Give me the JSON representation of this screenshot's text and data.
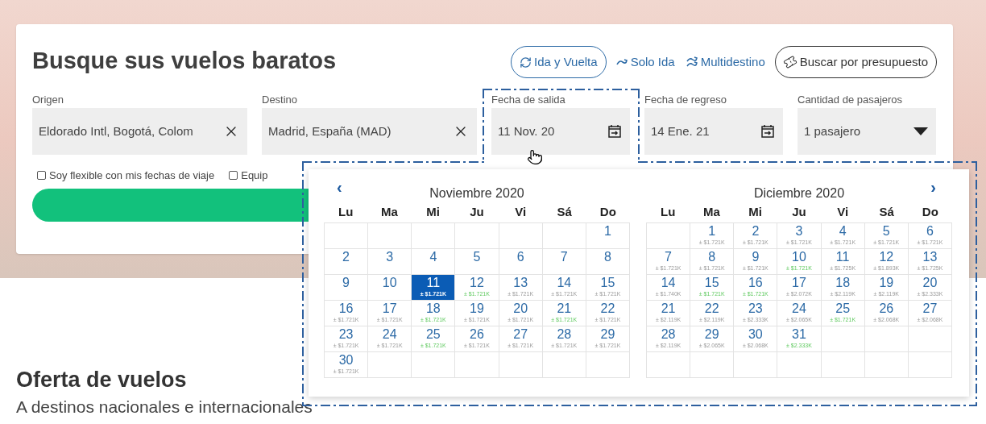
{
  "search": {
    "title": "Busque sus vuelos baratos",
    "modes": [
      {
        "label": "Ida y Vuelta",
        "kind": "round-trip",
        "selected": true
      },
      {
        "label": "Solo Ida",
        "kind": "one-way",
        "selected": false
      },
      {
        "label": "Multidestino",
        "kind": "multi-city",
        "selected": false
      }
    ],
    "budget_button": "Buscar por presupuesto",
    "fields": [
      {
        "label": "Origen",
        "value": "Eldorado Intl, Bogotá, Colom",
        "kind": "clearable"
      },
      {
        "label": "Destino",
        "value": "Madrid, España (MAD)",
        "kind": "clearable"
      },
      {
        "label": "Fecha de salida",
        "value": "11 Nov. 20",
        "kind": "date"
      },
      {
        "label": "Fecha de regreso",
        "value": "14 Ene. 21",
        "kind": "date"
      },
      {
        "label": "Cantidad de pasajeros",
        "value": "1 pasajero",
        "kind": "select"
      }
    ],
    "options": [
      {
        "label": "Soy flexible con mis fechas de viaje",
        "checked": false
      },
      {
        "label": "Equip",
        "checked": false
      }
    ]
  },
  "offers": {
    "title": "Oferta de vuelos",
    "subtitle": "A destinos nacionales e internacionales"
  },
  "calendar": {
    "prev": "‹",
    "next": "›",
    "months": [
      {
        "title": "Noviembre 2020",
        "weekdays": [
          "Lu",
          "Ma",
          "Mi",
          "Ju",
          "Vi",
          "Sá",
          "Do"
        ],
        "weeks": [
          [
            {
              "kind": "blank"
            },
            {
              "kind": "blank"
            },
            {
              "kind": "blank"
            },
            {
              "kind": "blank"
            },
            {
              "kind": "blank"
            },
            {
              "kind": "blank"
            },
            {
              "kind": "day",
              "day": "1",
              "selected": false
            }
          ],
          [
            {
              "kind": "day",
              "day": "2",
              "selected": false
            },
            {
              "kind": "day",
              "day": "3",
              "selected": false
            },
            {
              "kind": "day",
              "day": "4",
              "selected": false
            },
            {
              "kind": "day",
              "day": "5",
              "selected": false
            },
            {
              "kind": "day",
              "day": "6",
              "selected": false
            },
            {
              "kind": "day",
              "day": "7",
              "selected": false
            },
            {
              "kind": "day",
              "day": "8",
              "selected": false
            }
          ],
          [
            {
              "kind": "day",
              "day": "9",
              "selected": false
            },
            {
              "kind": "day",
              "day": "10",
              "selected": false
            },
            {
              "kind": "day",
              "day": "11",
              "price": "± $1.721K",
              "selected": true
            },
            {
              "kind": "day",
              "day": "12",
              "price": "± $1.721K",
              "cheap": true,
              "selected": false
            },
            {
              "kind": "day",
              "day": "13",
              "price": "± $1.721K",
              "cheap": false,
              "selected": false
            },
            {
              "kind": "day",
              "day": "14",
              "price": "± $1.721K",
              "cheap": false,
              "selected": false
            },
            {
              "kind": "day",
              "day": "15",
              "price": "± $1.721K",
              "cheap": false,
              "selected": false
            }
          ],
          [
            {
              "kind": "day",
              "day": "16",
              "price": "± $1.721K",
              "cheap": false,
              "selected": false
            },
            {
              "kind": "day",
              "day": "17",
              "price": "± $1.721K",
              "cheap": false,
              "selected": false
            },
            {
              "kind": "day",
              "day": "18",
              "price": "± $1.721K",
              "cheap": true,
              "selected": false
            },
            {
              "kind": "day",
              "day": "19",
              "price": "± $1.721K",
              "cheap": false,
              "selected": false
            },
            {
              "kind": "day",
              "day": "20",
              "price": "± $1.721K",
              "cheap": false,
              "selected": false
            },
            {
              "kind": "day",
              "day": "21",
              "price": "± $1.721K",
              "cheap": true,
              "selected": false
            },
            {
              "kind": "day",
              "day": "22",
              "price": "± $1.721K",
              "cheap": false,
              "selected": false
            }
          ],
          [
            {
              "kind": "day",
              "day": "23",
              "price": "± $1.721K",
              "cheap": false,
              "selected": false
            },
            {
              "kind": "day",
              "day": "24",
              "price": "± $1.721K",
              "cheap": false,
              "selected": false
            },
            {
              "kind": "day",
              "day": "25",
              "price": "± $1.721K",
              "cheap": true,
              "selected": false
            },
            {
              "kind": "day",
              "day": "26",
              "price": "± $1.721K",
              "cheap": false,
              "selected": false
            },
            {
              "kind": "day",
              "day": "27",
              "price": "± $1.721K",
              "cheap": false,
              "selected": false
            },
            {
              "kind": "day",
              "day": "28",
              "price": "± $1.721K",
              "cheap": false,
              "selected": false
            },
            {
              "kind": "day",
              "day": "29",
              "price": "± $1.721K",
              "cheap": false,
              "selected": false
            }
          ],
          [
            {
              "kind": "day",
              "day": "30",
              "price": "± $1.721K",
              "cheap": false,
              "selected": false
            },
            {
              "kind": "blank"
            },
            {
              "kind": "blank"
            },
            {
              "kind": "blank"
            },
            {
              "kind": "blank"
            },
            {
              "kind": "blank"
            },
            {
              "kind": "blank"
            }
          ]
        ]
      },
      {
        "title": "Diciembre 2020",
        "weekdays": [
          "Lu",
          "Ma",
          "Mi",
          "Ju",
          "Vi",
          "Sá",
          "Do"
        ],
        "weeks": [
          [
            {
              "kind": "blank"
            },
            {
              "kind": "day",
              "day": "1",
              "price": "± $1.721K",
              "cheap": false,
              "selected": false
            },
            {
              "kind": "day",
              "day": "2",
              "price": "± $1.721K",
              "cheap": false,
              "selected": false
            },
            {
              "kind": "day",
              "day": "3",
              "price": "± $1.721K",
              "cheap": false,
              "selected": false
            },
            {
              "kind": "day",
              "day": "4",
              "price": "± $1.721K",
              "cheap": false,
              "selected": false
            },
            {
              "kind": "day",
              "day": "5",
              "price": "± $1.721K",
              "cheap": false,
              "selected": false
            },
            {
              "kind": "day",
              "day": "6",
              "price": "± $1.721K",
              "cheap": false,
              "selected": false
            }
          ],
          [
            {
              "kind": "day",
              "day": "7",
              "price": "± $1.721K",
              "cheap": false,
              "selected": false
            },
            {
              "kind": "day",
              "day": "8",
              "price": "± $1.721K",
              "cheap": false,
              "selected": false
            },
            {
              "kind": "day",
              "day": "9",
              "price": "± $1.721K",
              "cheap": false,
              "selected": false
            },
            {
              "kind": "day",
              "day": "10",
              "price": "± $1.721K",
              "cheap": true,
              "selected": false
            },
            {
              "kind": "day",
              "day": "11",
              "price": "± $1.725K",
              "cheap": false,
              "selected": false
            },
            {
              "kind": "day",
              "day": "12",
              "price": "± $1.893K",
              "cheap": false,
              "selected": false
            },
            {
              "kind": "day",
              "day": "13",
              "price": "± $1.725K",
              "cheap": false,
              "selected": false
            }
          ],
          [
            {
              "kind": "day",
              "day": "14",
              "price": "± $1.740K",
              "cheap": false,
              "selected": false
            },
            {
              "kind": "day",
              "day": "15",
              "price": "± $1.721K",
              "cheap": true,
              "selected": false
            },
            {
              "kind": "day",
              "day": "16",
              "price": "± $1.721K",
              "cheap": true,
              "selected": false
            },
            {
              "kind": "day",
              "day": "17",
              "price": "± $2.072K",
              "cheap": false,
              "selected": false
            },
            {
              "kind": "day",
              "day": "18",
              "price": "± $2.119K",
              "cheap": false,
              "selected": false
            },
            {
              "kind": "day",
              "day": "19",
              "price": "± $2.119K",
              "cheap": false,
              "selected": false
            },
            {
              "kind": "day",
              "day": "20",
              "price": "± $2.333K",
              "cheap": false,
              "selected": false
            }
          ],
          [
            {
              "kind": "day",
              "day": "21",
              "price": "± $2.119K",
              "cheap": false,
              "selected": false
            },
            {
              "kind": "day",
              "day": "22",
              "price": "± $2.119K",
              "cheap": false,
              "selected": false
            },
            {
              "kind": "day",
              "day": "23",
              "price": "± $2.333K",
              "cheap": false,
              "selected": false
            },
            {
              "kind": "day",
              "day": "24",
              "price": "± $2.065K",
              "cheap": false,
              "selected": false
            },
            {
              "kind": "day",
              "day": "25",
              "price": "± $1.721K",
              "cheap": true,
              "selected": false
            },
            {
              "kind": "day",
              "day": "26",
              "price": "± $2.068K",
              "cheap": false,
              "selected": false
            },
            {
              "kind": "day",
              "day": "27",
              "price": "± $2.068K",
              "cheap": false,
              "selected": false
            }
          ],
          [
            {
              "kind": "day",
              "day": "28",
              "price": "± $2.119K",
              "cheap": false,
              "selected": false
            },
            {
              "kind": "day",
              "day": "29",
              "price": "± $2.065K",
              "cheap": false,
              "selected": false
            },
            {
              "kind": "day",
              "day": "30",
              "price": "± $2.068K",
              "cheap": false,
              "selected": false
            },
            {
              "kind": "day",
              "day": "31",
              "price": "± $2.333K",
              "cheap": true,
              "selected": false
            },
            {
              "kind": "blank"
            },
            {
              "kind": "blank"
            },
            {
              "kind": "blank"
            }
          ],
          [
            {
              "kind": "blank"
            },
            {
              "kind": "blank"
            },
            {
              "kind": "blank"
            },
            {
              "kind": "blank"
            },
            {
              "kind": "blank"
            },
            {
              "kind": "blank"
            },
            {
              "kind": "blank"
            }
          ]
        ]
      }
    ]
  }
}
